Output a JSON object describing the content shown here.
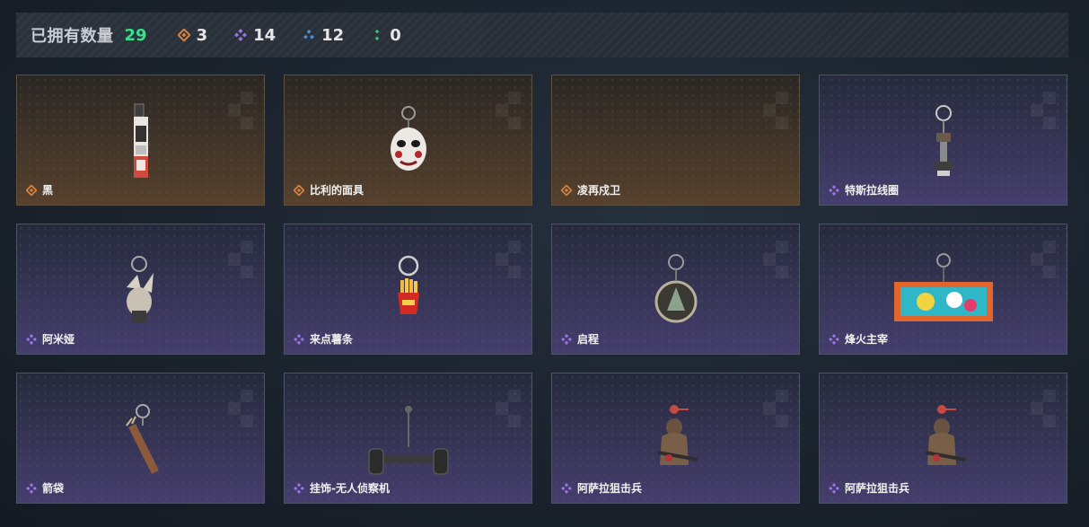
{
  "header": {
    "owned_label": "已拥有数量",
    "owned_count": "29",
    "stats": [
      {
        "icon": "gold-rarity-icon",
        "value": "3",
        "color": "#d9823f"
      },
      {
        "icon": "purple-rarity-icon",
        "value": "14",
        "color": "#9a73e6"
      },
      {
        "icon": "blue-rarity-icon",
        "value": "12",
        "color": "#4a8fd6"
      },
      {
        "icon": "green-rarity-icon",
        "value": "0",
        "color": "#35c47a"
      }
    ]
  },
  "colors": {
    "owned_count": "#36e28a",
    "gold": "#d9823f",
    "purple": "#9a73e6"
  },
  "items": [
    {
      "name": "黑",
      "rarity": "gold",
      "icon": "lighter-charm-icon"
    },
    {
      "name": "比利的面具",
      "rarity": "gold",
      "icon": "puppet-mask-charm-icon"
    },
    {
      "name": "凌再戍卫",
      "rarity": "gold",
      "icon": ""
    },
    {
      "name": "特斯拉线圈",
      "rarity": "purple",
      "icon": "tesla-coil-charm-icon"
    },
    {
      "name": "阿米娅",
      "rarity": "purple",
      "icon": "bunny-charm-icon"
    },
    {
      "name": "来点薯条",
      "rarity": "purple",
      "icon": "fries-charm-icon"
    },
    {
      "name": "启程",
      "rarity": "purple",
      "icon": "medallion-charm-icon"
    },
    {
      "name": "烽火主宰",
      "rarity": "purple",
      "icon": "graffiti-plate-charm-icon"
    },
    {
      "name": "箭袋",
      "rarity": "purple",
      "icon": "quiver-charm-icon"
    },
    {
      "name": "挂饰-无人侦察机",
      "rarity": "purple",
      "icon": "drone-charm-icon"
    },
    {
      "name": "阿萨拉狙击兵",
      "rarity": "purple",
      "icon": "sniper-figure-charm-icon"
    },
    {
      "name": "阿萨拉狙击兵",
      "rarity": "purple",
      "icon": "sniper-figure-charm-icon"
    }
  ]
}
